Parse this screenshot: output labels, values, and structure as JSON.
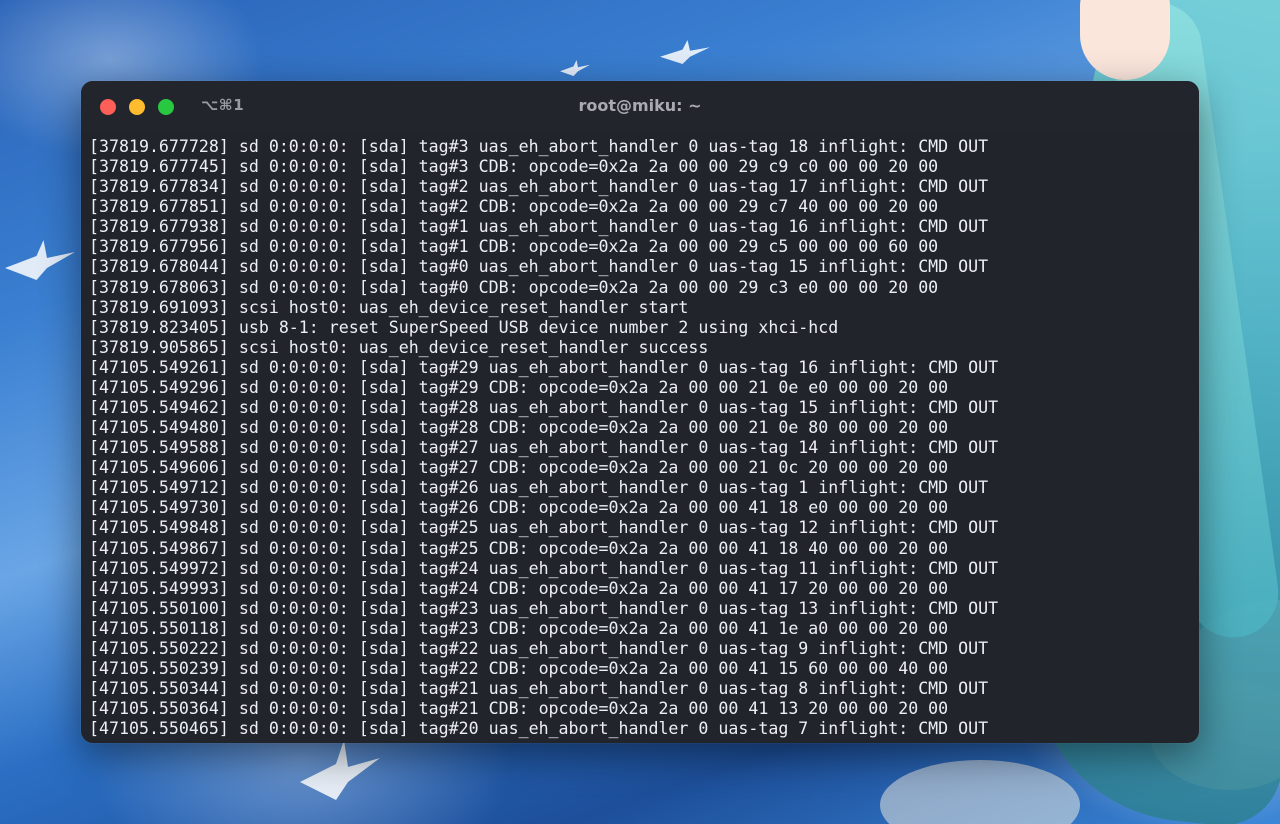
{
  "window": {
    "shortcut": "⌥⌘1",
    "title": "root@miku: ~"
  },
  "colors": {
    "window_bg": "#22242b",
    "text": "#eceff4",
    "close": "#fe5f57",
    "minimize": "#febc2e",
    "maximize": "#28c840"
  },
  "terminal": {
    "lines": [
      "[37819.677728] sd 0:0:0:0: [sda] tag#3 uas_eh_abort_handler 0 uas-tag 18 inflight: CMD OUT",
      "[37819.677745] sd 0:0:0:0: [sda] tag#3 CDB: opcode=0x2a 2a 00 00 29 c9 c0 00 00 20 00",
      "[37819.677834] sd 0:0:0:0: [sda] tag#2 uas_eh_abort_handler 0 uas-tag 17 inflight: CMD OUT",
      "[37819.677851] sd 0:0:0:0: [sda] tag#2 CDB: opcode=0x2a 2a 00 00 29 c7 40 00 00 20 00",
      "[37819.677938] sd 0:0:0:0: [sda] tag#1 uas_eh_abort_handler 0 uas-tag 16 inflight: CMD OUT",
      "[37819.677956] sd 0:0:0:0: [sda] tag#1 CDB: opcode=0x2a 2a 00 00 29 c5 00 00 00 60 00",
      "[37819.678044] sd 0:0:0:0: [sda] tag#0 uas_eh_abort_handler 0 uas-tag 15 inflight: CMD OUT",
      "[37819.678063] sd 0:0:0:0: [sda] tag#0 CDB: opcode=0x2a 2a 00 00 29 c3 e0 00 00 20 00",
      "[37819.691093] scsi host0: uas_eh_device_reset_handler start",
      "[37819.823405] usb 8-1: reset SuperSpeed USB device number 2 using xhci-hcd",
      "[37819.905865] scsi host0: uas_eh_device_reset_handler success",
      "[47105.549261] sd 0:0:0:0: [sda] tag#29 uas_eh_abort_handler 0 uas-tag 16 inflight: CMD OUT",
      "[47105.549296] sd 0:0:0:0: [sda] tag#29 CDB: opcode=0x2a 2a 00 00 21 0e e0 00 00 20 00",
      "[47105.549462] sd 0:0:0:0: [sda] tag#28 uas_eh_abort_handler 0 uas-tag 15 inflight: CMD OUT",
      "[47105.549480] sd 0:0:0:0: [sda] tag#28 CDB: opcode=0x2a 2a 00 00 21 0e 80 00 00 20 00",
      "[47105.549588] sd 0:0:0:0: [sda] tag#27 uas_eh_abort_handler 0 uas-tag 14 inflight: CMD OUT",
      "[47105.549606] sd 0:0:0:0: [sda] tag#27 CDB: opcode=0x2a 2a 00 00 21 0c 20 00 00 20 00",
      "[47105.549712] sd 0:0:0:0: [sda] tag#26 uas_eh_abort_handler 0 uas-tag 1 inflight: CMD OUT",
      "[47105.549730] sd 0:0:0:0: [sda] tag#26 CDB: opcode=0x2a 2a 00 00 41 18 e0 00 00 20 00",
      "[47105.549848] sd 0:0:0:0: [sda] tag#25 uas_eh_abort_handler 0 uas-tag 12 inflight: CMD OUT",
      "[47105.549867] sd 0:0:0:0: [sda] tag#25 CDB: opcode=0x2a 2a 00 00 41 18 40 00 00 20 00",
      "[47105.549972] sd 0:0:0:0: [sda] tag#24 uas_eh_abort_handler 0 uas-tag 11 inflight: CMD OUT",
      "[47105.549993] sd 0:0:0:0: [sda] tag#24 CDB: opcode=0x2a 2a 00 00 41 17 20 00 00 20 00",
      "[47105.550100] sd 0:0:0:0: [sda] tag#23 uas_eh_abort_handler 0 uas-tag 13 inflight: CMD OUT",
      "[47105.550118] sd 0:0:0:0: [sda] tag#23 CDB: opcode=0x2a 2a 00 00 41 1e a0 00 00 20 00",
      "[47105.550222] sd 0:0:0:0: [sda] tag#22 uas_eh_abort_handler 0 uas-tag 9 inflight: CMD OUT",
      "[47105.550239] sd 0:0:0:0: [sda] tag#22 CDB: opcode=0x2a 2a 00 00 41 15 60 00 00 40 00",
      "[47105.550344] sd 0:0:0:0: [sda] tag#21 uas_eh_abort_handler 0 uas-tag 8 inflight: CMD OUT",
      "[47105.550364] sd 0:0:0:0: [sda] tag#21 CDB: opcode=0x2a 2a 00 00 41 13 20 00 00 20 00",
      "[47105.550465] sd 0:0:0:0: [sda] tag#20 uas_eh_abort_handler 0 uas-tag 7 inflight: CMD OUT"
    ]
  }
}
